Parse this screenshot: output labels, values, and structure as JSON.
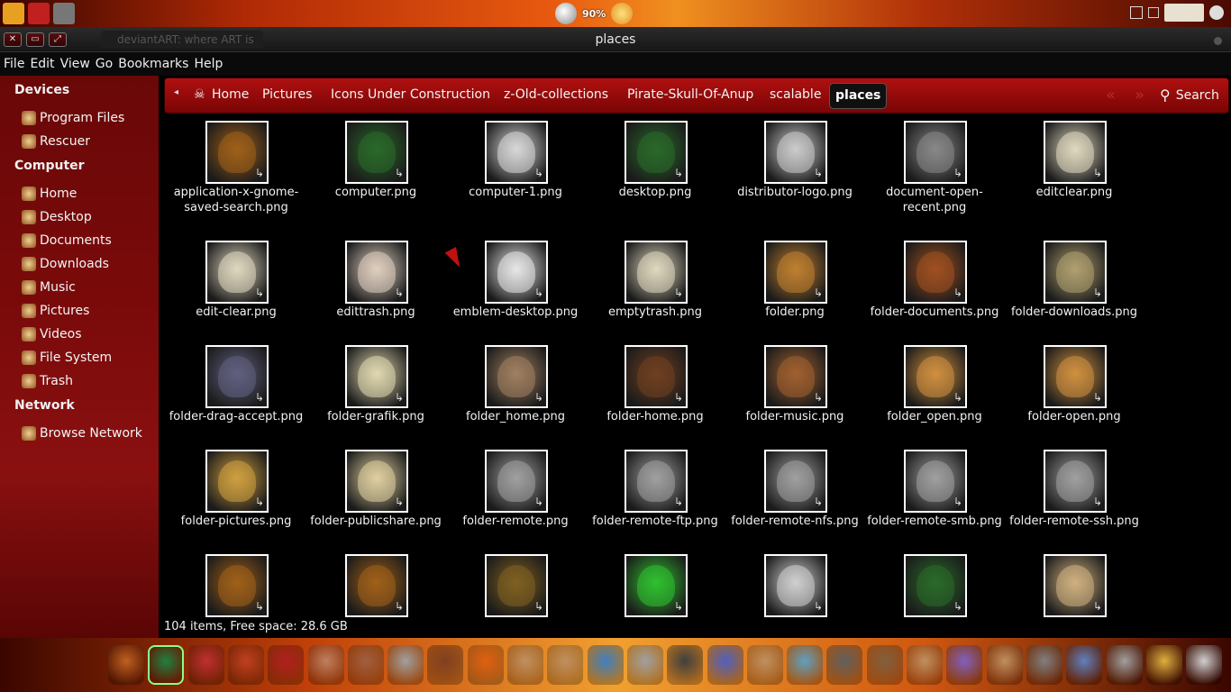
{
  "top_panel": {
    "battery_percent": "90%",
    "launchers": [
      {
        "icon": "ubuntu-launcher-icon",
        "color": "#e8a020"
      },
      {
        "icon": "pirate-flag-icon",
        "color": "#c02020"
      },
      {
        "icon": "skull-app-icon",
        "color": "#777777"
      }
    ]
  },
  "window": {
    "title": "places",
    "background_tab": "deviantART: where ART is"
  },
  "menu": [
    "File",
    "Edit",
    "View",
    "Go",
    "Bookmarks",
    "Help"
  ],
  "sidebar": {
    "sections": [
      {
        "header": "Devices",
        "items": [
          {
            "label": "Program Files",
            "icon": "drive-icon"
          },
          {
            "label": "Rescuer",
            "icon": "drive-icon"
          }
        ]
      },
      {
        "header": "Computer",
        "items": [
          {
            "label": "Home",
            "icon": "home-folder-icon"
          },
          {
            "label": "Desktop",
            "icon": "desktop-folder-icon"
          },
          {
            "label": "Documents",
            "icon": "documents-folder-icon"
          },
          {
            "label": "Downloads",
            "icon": "downloads-folder-icon"
          },
          {
            "label": "Music",
            "icon": "music-folder-icon"
          },
          {
            "label": "Pictures",
            "icon": "pictures-folder-icon"
          },
          {
            "label": "Videos",
            "icon": "videos-folder-icon"
          },
          {
            "label": "File System",
            "icon": "filesystem-icon"
          },
          {
            "label": "Trash",
            "icon": "trash-icon"
          }
        ]
      },
      {
        "header": "Network",
        "items": [
          {
            "label": "Browse Network",
            "icon": "network-icon"
          }
        ]
      }
    ]
  },
  "pathbar": {
    "crumbs": [
      "Home",
      "Pictures",
      "Icons Under Construction",
      "z-Old-collections",
      "Pirate-Skull-Of-Anup",
      "scalable"
    ],
    "current": "places",
    "search_label": "Search"
  },
  "files": [
    {
      "name": "application-x-gnome-saved-search.png",
      "color": "#a0601a"
    },
    {
      "name": "computer.png",
      "color": "#2a6a2a"
    },
    {
      "name": "computer-1.png",
      "color": "#d8d8d8"
    },
    {
      "name": "desktop.png",
      "color": "#2a6a2a"
    },
    {
      "name": "distributor-logo.png",
      "color": "#cccccc"
    },
    {
      "name": "document-open-recent.png",
      "color": "#888888"
    },
    {
      "name": "editclear.png",
      "color": "#e0d8c0"
    },
    {
      "name": "edit-clear.png",
      "color": "#e0d8c0"
    },
    {
      "name": "edittrash.png",
      "color": "#e0d0c0"
    },
    {
      "name": "emblem-desktop.png",
      "color": "#e8e8e8"
    },
    {
      "name": "emptytrash.png",
      "color": "#e0d8c0"
    },
    {
      "name": "folder.png",
      "color": "#c08030"
    },
    {
      "name": "folder-documents.png",
      "color": "#a05020"
    },
    {
      "name": "folder-downloads.png",
      "color": "#b0a070"
    },
    {
      "name": "folder-drag-accept.png",
      "color": "#606080"
    },
    {
      "name": "folder-grafik.png",
      "color": "#e0d8b0"
    },
    {
      "name": "folder_home.png",
      "color": "#a08060"
    },
    {
      "name": "folder-home.png",
      "color": "#704020"
    },
    {
      "name": "folder-music.png",
      "color": "#a06030"
    },
    {
      "name": "folder_open.png",
      "color": "#d09040"
    },
    {
      "name": "folder-open.png",
      "color": "#d09040"
    },
    {
      "name": "folder-pictures.png",
      "color": "#d0a040"
    },
    {
      "name": "folder-publicshare.png",
      "color": "#e0d0a0"
    },
    {
      "name": "folder-remote.png",
      "color": "#a0a0a0"
    },
    {
      "name": "folder-remote-ftp.png",
      "color": "#a0a0a0"
    },
    {
      "name": "folder-remote-nfs.png",
      "color": "#a0a0a0"
    },
    {
      "name": "folder-remote-smb.png",
      "color": "#a0a0a0"
    },
    {
      "name": "folder-remote-ssh.png",
      "color": "#a0a0a0"
    },
    {
      "name": "",
      "color": "#a0601a"
    },
    {
      "name": "",
      "color": "#a0601a"
    },
    {
      "name": "",
      "color": "#806020"
    },
    {
      "name": "",
      "color": "#30c030"
    },
    {
      "name": "",
      "color": "#d0d0d0"
    },
    {
      "name": "",
      "color": "#2a6a2a"
    },
    {
      "name": "",
      "color": "#d0b080"
    }
  ],
  "status": "104 items, Free space: 28.6 GB",
  "dock": {
    "icons": [
      "pirate-skull-icon",
      "skull-green-icon",
      "pirate-icon",
      "skull-crossbones-icon",
      "red-skull-icon",
      "warrior-icon",
      "viking-icon",
      "skull-icon",
      "bat-icon",
      "fire-skull-icon",
      "warrior-icon",
      "warrior-icon",
      "ring-icon",
      "skull-gear-icon",
      "skull-dark-icon",
      "globe-icon",
      "warrior-icon",
      "dancer-icon",
      "helmet-icon",
      "creature-icon",
      "warrior-icon",
      "crystal-icon",
      "warrior-icon",
      "skull-spikes-icon",
      "music-note-icon",
      "ghost-icon",
      "lantern-icon",
      "skull-icon"
    ],
    "colors": [
      "#c06020",
      "#208040",
      "#c03030",
      "#c04020",
      "#b02020",
      "#c08060",
      "#a06040",
      "#a0a0a0",
      "#804020",
      "#e06010",
      "#c09060",
      "#c09060",
      "#4080c0",
      "#a0a0a0",
      "#404040",
      "#5060c0",
      "#c09060",
      "#60a0c0",
      "#606060",
      "#806040",
      "#c09060",
      "#8060c0",
      "#c09060",
      "#808080",
      "#6080c0",
      "#a0a0a0",
      "#e0b040",
      "#d0d0d0"
    ]
  }
}
